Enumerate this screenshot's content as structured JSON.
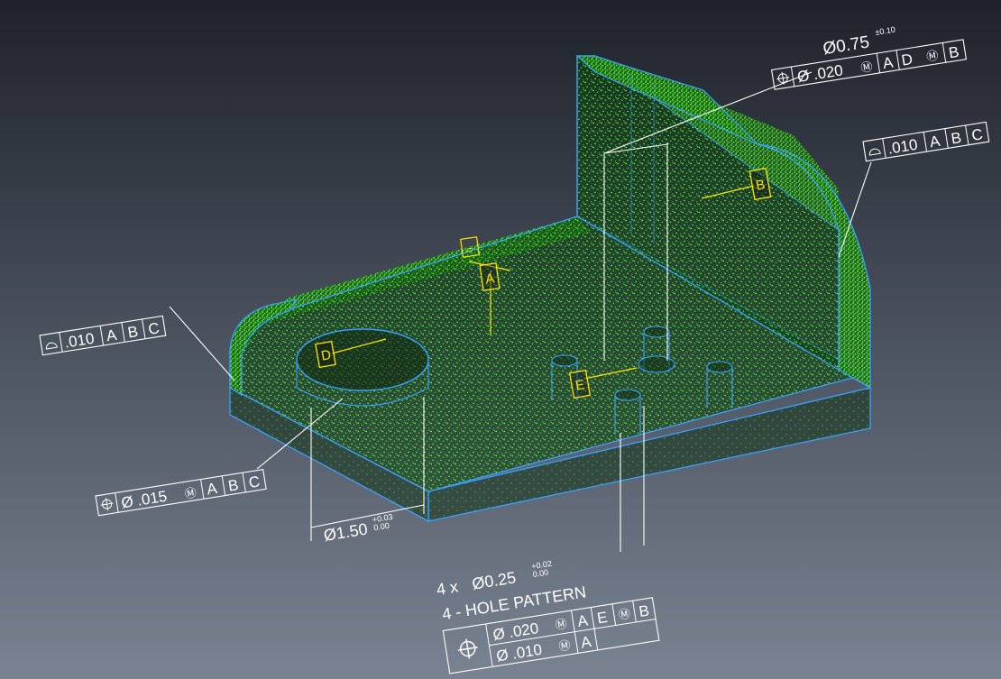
{
  "colors": {
    "background_top": "#1e222a",
    "background_bottom": "#7a8391",
    "part_edge": "#3aa0ff",
    "point_cloud": "#4cff2a",
    "annotation": "#ffffff",
    "datum": "#ffe600"
  },
  "datums": {
    "a": "A",
    "b": "B",
    "d": "D",
    "e": "E"
  },
  "fcf_top_right": {
    "dim": "Ø0.75",
    "tol": "±0.10",
    "symbol": "position-icon",
    "value": "Ø .020",
    "modifier": "Ⓜ",
    "ref1": "A",
    "ref2": "D",
    "ref2_modifier": "Ⓜ",
    "ref3": "B"
  },
  "fcf_right_profile": {
    "symbol": "profile-of-surface-icon",
    "value": ".010",
    "ref1": "A",
    "ref2": "B",
    "ref3": "C"
  },
  "fcf_left_profile": {
    "symbol": "profile-of-surface-icon",
    "value": ".010",
    "ref1": "A",
    "ref2": "B",
    "ref3": "C"
  },
  "fcf_left_position": {
    "symbol": "position-icon",
    "value": "Ø .015",
    "modifier": "Ⓜ",
    "ref1": "A",
    "ref2": "B",
    "ref3": "C"
  },
  "dim_bore": {
    "value": "Ø1.50",
    "tol_upper": "+0.03",
    "tol_lower": "0.00"
  },
  "hole_pattern": {
    "count": "4 x",
    "dim": "Ø0.25",
    "tol_upper": "+0.02",
    "tol_lower": "0.00",
    "label": "4 - HOLE PATTERN",
    "symbol": "position-icon",
    "row1_value": "Ø .020",
    "row1_modifier": "Ⓜ",
    "row1_ref1": "A",
    "row1_ref2": "E",
    "row1_ref2_modifier": "Ⓜ",
    "row1_ref3": "B",
    "row2_value": "Ø .010",
    "row2_modifier": "Ⓜ",
    "row2_ref1": "A"
  }
}
